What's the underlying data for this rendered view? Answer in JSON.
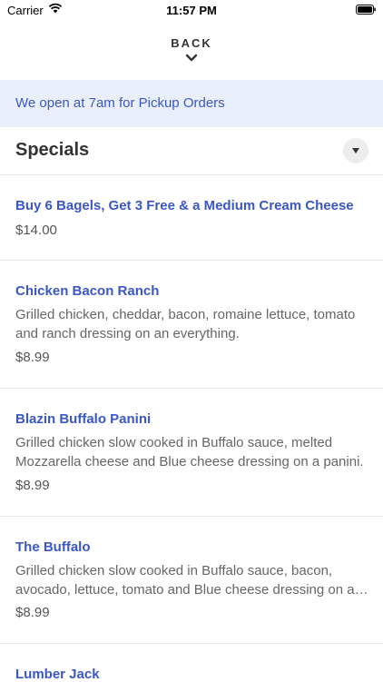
{
  "status_bar": {
    "carrier": "Carrier",
    "time": "11:57 PM"
  },
  "nav": {
    "back_label": "BACK"
  },
  "banner": {
    "text": "We open at 7am for Pickup Orders"
  },
  "section": {
    "title": "Specials"
  },
  "items": [
    {
      "name": "Buy 6 Bagels, Get 3 Free & a Medium Cream Cheese",
      "description": "",
      "price": "$14.00"
    },
    {
      "name": "Chicken Bacon Ranch",
      "description_lines": [
        "Grilled chicken, cheddar, bacon, romaine lettuce, tomato",
        "and ranch dressing on an everything."
      ],
      "price": "$8.99"
    },
    {
      "name": "Blazin Buffalo Panini",
      "description_lines": [
        "Grilled chicken slow cooked in Buffalo sauce, melted",
        "Mozzarella cheese and Blue cheese dressing on a panini."
      ],
      "price": "$8.99"
    },
    {
      "name": "The Buffalo",
      "description_lines": [
        "Grilled chicken slow cooked in Buffalo sauce, bacon,",
        "avocado, lettuce, tomato and Blue cheese dressing on a…"
      ],
      "price": "$8.99"
    },
    {
      "name": "Lumber Jack"
    }
  ],
  "colors": {
    "accent": "#3b57c4",
    "banner_bg": "#eaf0fb"
  }
}
